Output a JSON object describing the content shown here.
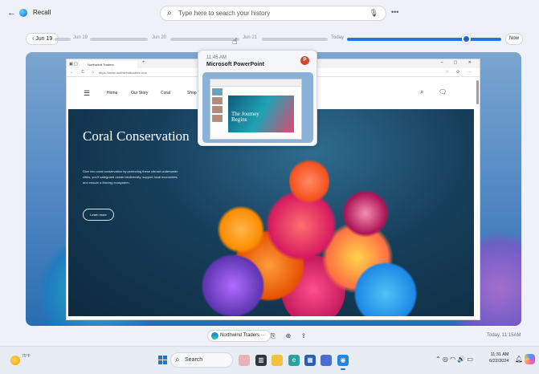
{
  "app": {
    "title": "Recall",
    "back_icon": "arrow-left-icon"
  },
  "search": {
    "placeholder": "Type here to search your history",
    "icon": "search-icon",
    "mic_icon": "microphone-icon",
    "more_icon": "ellipsis-icon",
    "more_label": "•••"
  },
  "timeline": {
    "back_label": "‹ Jun 19",
    "labels": [
      "Jun 19",
      "Jun 20",
      "Jun 21",
      "Today"
    ],
    "now_label": "Now",
    "position_fraction": 0.93
  },
  "preview": {
    "time": "11:45 AM",
    "app_name": "Microsoft PowerPoint",
    "app_icon": "powerpoint-icon",
    "app_icon_letter": "P",
    "slide_title": "The Journey Begins"
  },
  "browser": {
    "tab_title": "Northwind Traders",
    "url": "https://www.northwindtraders.com",
    "win_controls": "–  ▢  ✕",
    "nav_buttons": "←  C  ⌂",
    "toolbar_icons": "☆  ⟳  ⋯"
  },
  "site": {
    "nav": [
      "Home",
      "Our Story",
      "Coral",
      "Shop"
    ],
    "hero_title": "Coral Conservation",
    "hero_text": "Dive into coral conservation by protecting these vibrant underwater cities, you'll safeguard ocean biodiversity, support local economies, and ensure a thriving ecosystem.",
    "hero_button": "Learn more"
  },
  "context_bar": {
    "app_label": "Northwind Traders",
    "more": "···",
    "actions": [
      "copy-icon",
      "web-search-icon",
      "share-icon"
    ]
  },
  "timestamp": "Today, 11:15AM",
  "taskbar": {
    "search_label": "Search",
    "weather_text": "75°F",
    "clock_time": "11:31 AM",
    "clock_date": "6/22/2024",
    "tray_icons": "⌃   ◎   ◠  🔊  ▭"
  },
  "colors": {
    "accent": "#1f62c8",
    "timeline_track": "#c9ced8"
  }
}
